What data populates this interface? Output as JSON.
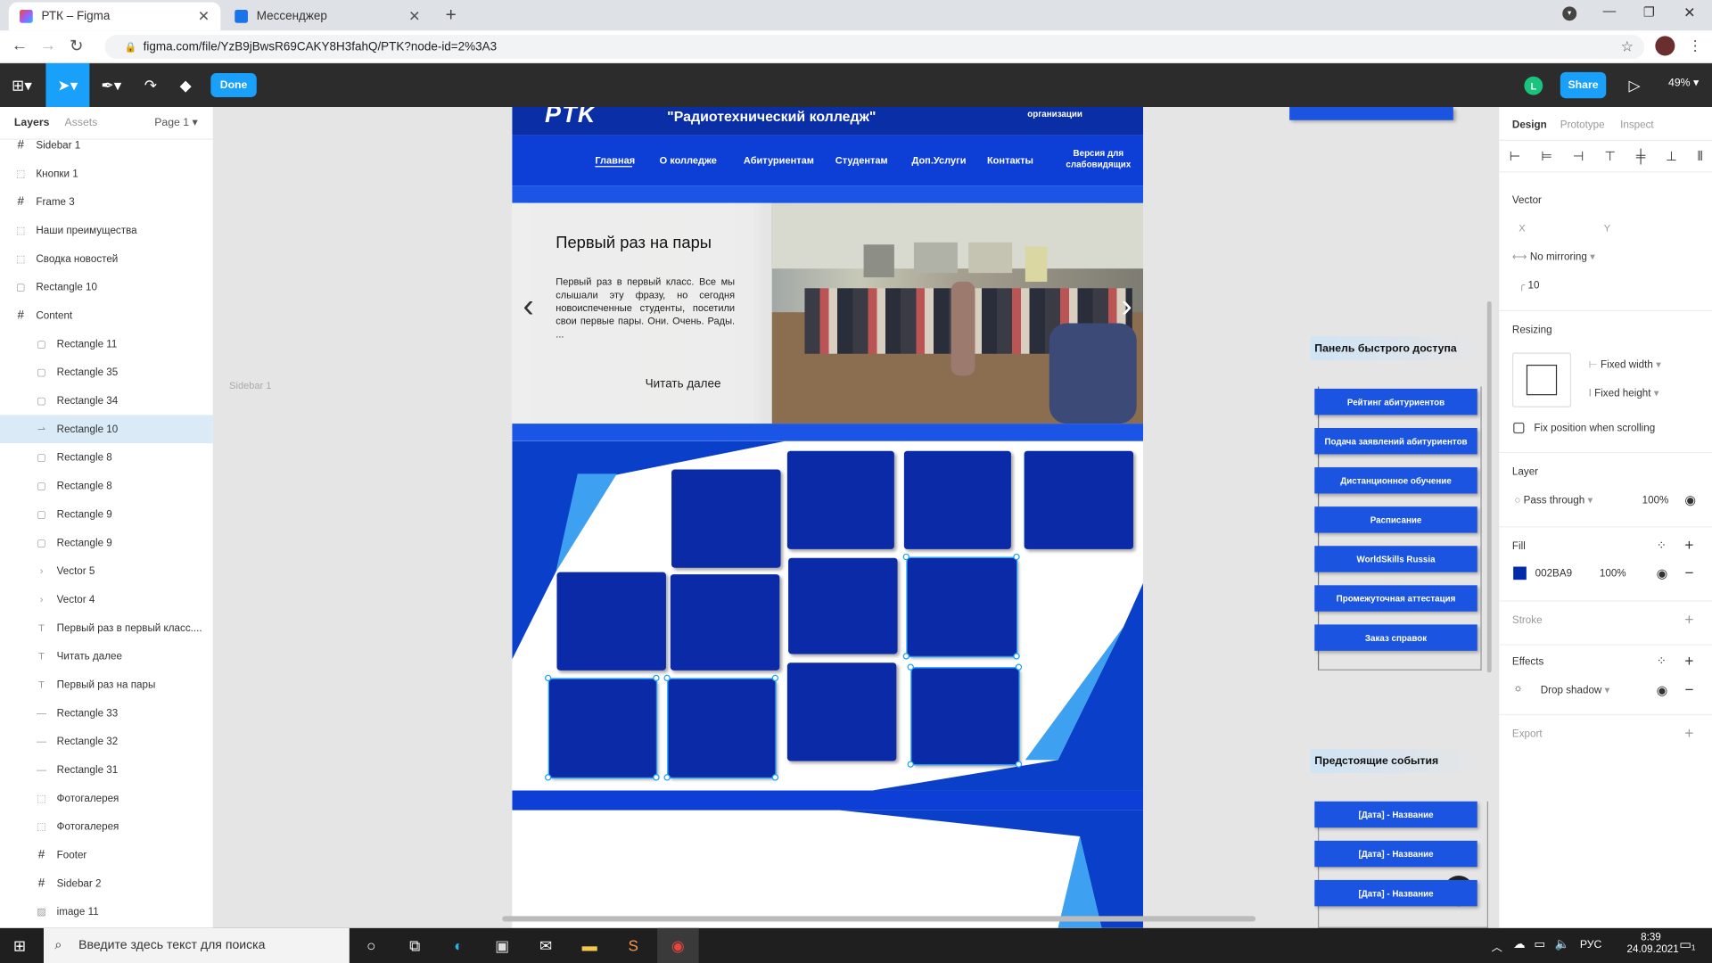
{
  "browser": {
    "tabs": [
      {
        "label": "РТК – Figma",
        "active": true
      },
      {
        "label": "Мессенджер",
        "active": false
      }
    ],
    "url": "figma.com/file/YzB9jBwsR69CAKY8H3fahQ/PTK?node-id=2%3A3"
  },
  "toolbar": {
    "done_label": "Done",
    "share_label": "Share",
    "avatar_letter": "L",
    "zoom": "49%"
  },
  "layers_panel": {
    "tab_layers": "Layers",
    "tab_assets": "Assets",
    "page": "Page 1",
    "items": [
      {
        "label": "Sidebar 1",
        "icon": "frame-icon",
        "indent": 0
      },
      {
        "label": "Кнопки 1",
        "icon": "group-icon",
        "indent": 0
      },
      {
        "label": "Frame 3",
        "icon": "frame-icon",
        "indent": 0
      },
      {
        "label": "Наши преимущества",
        "icon": "group-icon",
        "indent": 0
      },
      {
        "label": "Сводка новостей",
        "icon": "group-icon",
        "indent": 0
      },
      {
        "label": "Rectangle 10",
        "icon": "rect-icon",
        "indent": 0
      },
      {
        "label": "Content",
        "icon": "frame-icon",
        "indent": 0
      },
      {
        "label": "Rectangle 11",
        "icon": "rect-icon",
        "indent": 1
      },
      {
        "label": "Rectangle 35",
        "icon": "rect-icon",
        "indent": 1
      },
      {
        "label": "Rectangle 34",
        "icon": "rect-icon",
        "indent": 1
      },
      {
        "label": "Rectangle 10",
        "icon": "vector-edit-icon",
        "indent": 1,
        "selected": true
      },
      {
        "label": "Rectangle 8",
        "icon": "rect-icon",
        "indent": 1
      },
      {
        "label": "Rectangle 8",
        "icon": "rect-icon",
        "indent": 1
      },
      {
        "label": "Rectangle 9",
        "icon": "rect-icon",
        "indent": 1
      },
      {
        "label": "Rectangle 9",
        "icon": "rect-icon",
        "indent": 1
      },
      {
        "label": "Vector 5",
        "icon": "vector-icon",
        "indent": 1
      },
      {
        "label": "Vector 4",
        "icon": "vector-icon",
        "indent": 1
      },
      {
        "label": "Первый раз в первый класс....",
        "icon": "text-icon",
        "indent": 1
      },
      {
        "label": "Читать далее",
        "icon": "text-icon",
        "indent": 1
      },
      {
        "label": "Первый раз на пары",
        "icon": "text-icon",
        "indent": 1
      },
      {
        "label": "Rectangle 33",
        "icon": "line-icon",
        "indent": 1
      },
      {
        "label": "Rectangle 32",
        "icon": "line-icon",
        "indent": 1
      },
      {
        "label": "Rectangle 31",
        "icon": "line-icon",
        "indent": 1
      },
      {
        "label": "Фотогалерея",
        "icon": "group-icon",
        "indent": 1
      },
      {
        "label": "Фотогалерея",
        "icon": "group-icon",
        "indent": 1
      },
      {
        "label": "Footer",
        "icon": "frame-icon",
        "indent": 1
      },
      {
        "label": "Sidebar 2",
        "icon": "frame-icon",
        "indent": 1
      },
      {
        "label": "image 11",
        "icon": "image-icon",
        "indent": 1
      }
    ]
  },
  "canvas": {
    "frame_label": "Sidebar 1",
    "site": {
      "college_name": "\"Радиотехнический колледж\"",
      "header_right": "организации",
      "logo_text": "PTK",
      "nav": [
        "Главная",
        "О колледже",
        "Абитуриентам",
        "Студентам",
        "Доп.Услуги",
        "Контакты"
      ],
      "nav_accessible": "Версия для слабовидящих",
      "hero_title": "Первый раз на пары",
      "hero_text": "Первый раз в первый класс. Все мы слышали эту фразу, но сегодня новоиспеченные студенты, посетили свои первые пары. Они. Очень. Рады. ...",
      "hero_more": "Читать далее"
    },
    "sidebar": {
      "quick_title": "Панель быстрого доступа",
      "quick_buttons": [
        "Рейтинг абитуриентов",
        "Подача заявлений абитуриентов",
        "Дистанционное обучение",
        "Расписание",
        "WorldSkills Russia",
        "Промежуточная аттестация",
        "Заказ справок"
      ],
      "events_title": "Предстоящие события",
      "events": [
        "[Дата] - Название",
        "[Дата] - Название",
        "[Дата] - Название"
      ]
    }
  },
  "props_panel": {
    "tabs": [
      "Design",
      "Prototype",
      "Inspect"
    ],
    "vector_title": "Vector",
    "x_label": "X",
    "y_label": "Y",
    "mirroring": "No mirroring",
    "corner_radius": "10",
    "resizing_title": "Resizing",
    "fixed_width": "Fixed width",
    "fixed_height": "Fixed height",
    "fix_position": "Fix position when scrolling",
    "layer_title": "Layer",
    "blend": "Pass through",
    "layer_opacity": "100%",
    "fill_title": "Fill",
    "fill_hex": "002BA9",
    "fill_color": "#002BA9",
    "fill_opacity": "100%",
    "stroke_title": "Stroke",
    "effects_title": "Effects",
    "effect": "Drop shadow",
    "export_title": "Export",
    "help": "?"
  },
  "taskbar": {
    "search_placeholder": "Введите здесь текст для поиска",
    "lang": "РУС",
    "time": "8:39",
    "date": "24.09.2021",
    "notif_count": "1"
  }
}
